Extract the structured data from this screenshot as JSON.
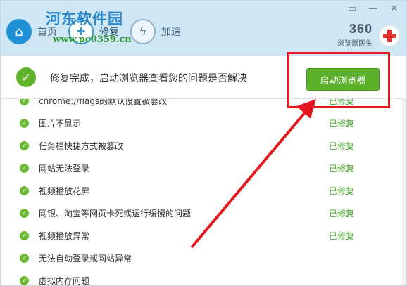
{
  "watermark": {
    "site": "河东软件园",
    "url": "www.pc0359.cn"
  },
  "header": {
    "tabs": [
      {
        "label": "首页",
        "icon": "home-icon"
      },
      {
        "label": "修复",
        "icon": "wrench-icon"
      },
      {
        "label": "加速",
        "icon": "lightning-icon"
      }
    ],
    "brand_number": "360",
    "brand_name": "浏览器医生"
  },
  "status": {
    "message": "修复完成，启动浏览器查看您的问题是否解决",
    "launch_button": "启动浏览器"
  },
  "issues": [
    {
      "label": "chrome://flags的默认设置被篡改",
      "status": "已修复"
    },
    {
      "label": "图片不显示",
      "status": "已修复"
    },
    {
      "label": "任务栏快捷方式被篡改",
      "status": "已修复"
    },
    {
      "label": "网站无法登录",
      "status": "已修复"
    },
    {
      "label": "视频播放花屏",
      "status": "已修复"
    },
    {
      "label": "网银、淘宝等网页卡死或运行缓慢的问题",
      "status": "已修复"
    },
    {
      "label": "视频播放异常",
      "status": "已修复"
    },
    {
      "label": "无法自动登录或网站异常",
      "status": ""
    },
    {
      "label": "虚拟内存问题",
      "status": ""
    }
  ],
  "colors": {
    "accent_green": "#5cb12a",
    "highlight_red": "#e3191f",
    "header_bg": "#cfe6f5"
  }
}
